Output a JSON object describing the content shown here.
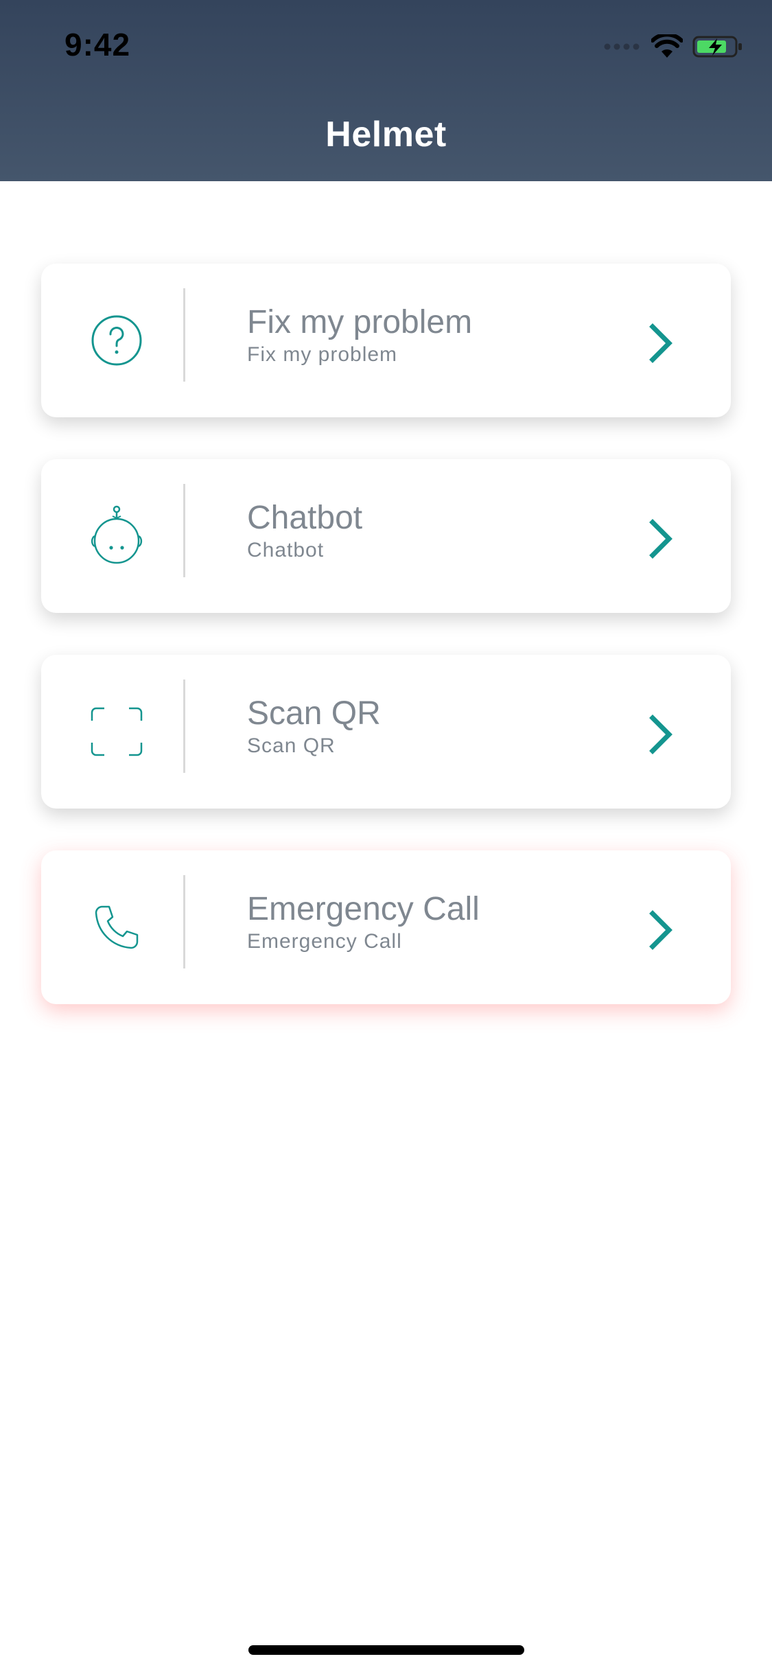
{
  "status_bar": {
    "time": "9:42",
    "icons": [
      "signal-dots-icon",
      "wifi-icon",
      "battery-charging-icon"
    ]
  },
  "header": {
    "title": "Helmet"
  },
  "colors": {
    "header_top": "#34445c",
    "header_bottom": "#45566c",
    "accent_teal": "#14958f",
    "text_gray": "#7f8790",
    "battery_green": "#4cd964",
    "emergency_glow": "#ff5050"
  },
  "menu": {
    "items": [
      {
        "icon": "question-circle-icon",
        "title": "Fix my problem",
        "subtitle": "Fix my problem"
      },
      {
        "icon": "robot-head-icon",
        "title": "Chatbot",
        "subtitle": "Chatbot"
      },
      {
        "icon": "scan-frame-icon",
        "title": "Scan QR",
        "subtitle": "Scan QR"
      },
      {
        "icon": "phone-icon",
        "title": "Emergency Call",
        "subtitle": "Emergency Call"
      }
    ]
  }
}
